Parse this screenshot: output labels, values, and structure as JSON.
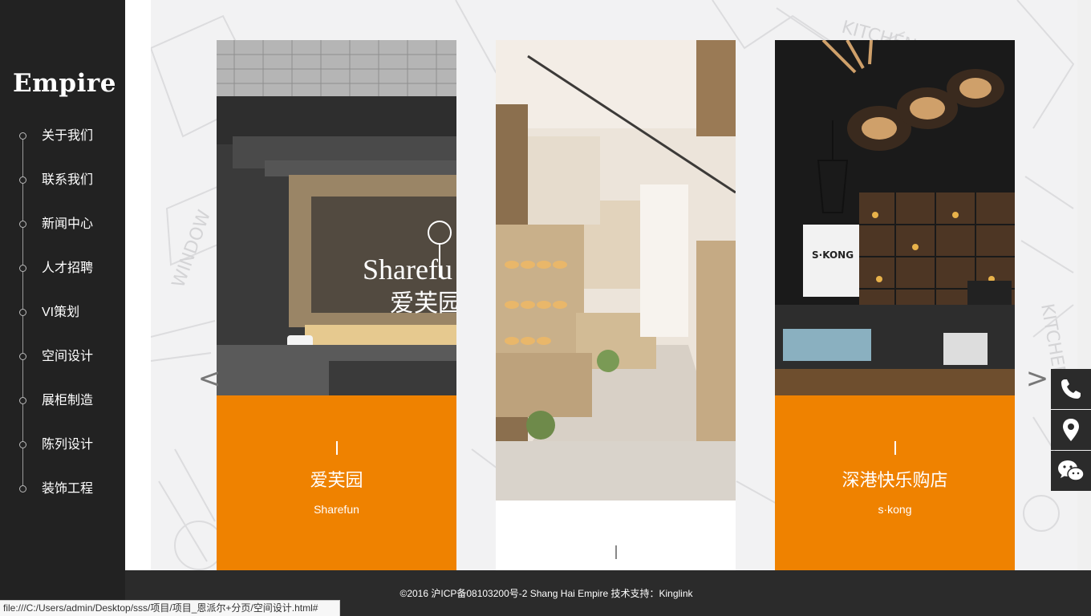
{
  "brand": {
    "logo_text": "Empire"
  },
  "nav": {
    "items": [
      {
        "label": "关于我们"
      },
      {
        "label": "联系我们"
      },
      {
        "label": "新闻中心"
      },
      {
        "label": "人才招聘"
      },
      {
        "label": "VI策划"
      },
      {
        "label": "空间设计"
      },
      {
        "label": "展柜制造"
      },
      {
        "label": "陈列设计"
      },
      {
        "label": "装饰工程"
      }
    ]
  },
  "carousel": {
    "prev_label": "<",
    "next_label": ">",
    "cards": [
      {
        "title": "爱芙园",
        "subtitle": "Sharefun",
        "photo": "sharefun storefront",
        "sign_text_en": "Sharefu",
        "sign_text_cn": "爱芙园"
      },
      {
        "title": "",
        "subtitle": "",
        "photo": "bakery interior"
      },
      {
        "title": "深港快乐购店",
        "subtitle": "s·kong",
        "photo": "cafe interior",
        "sign_text": "S·KONG"
      }
    ]
  },
  "side_tools": [
    {
      "icon": "phone-icon"
    },
    {
      "icon": "location-icon"
    },
    {
      "icon": "wechat-icon"
    }
  ],
  "footer": {
    "copyright": "©2016  沪ICP备08103200号-2 Shang  Hai  Empire  技术支持：Kinglink"
  },
  "status_bar": {
    "url": "file:///C:/Users/admin/Desktop/sss/项目/项目_恩派尔+分页/空间设计.html#"
  },
  "colors": {
    "accent": "#ef8200",
    "sidebar": "#222222",
    "footer": "#2b2b2b"
  }
}
